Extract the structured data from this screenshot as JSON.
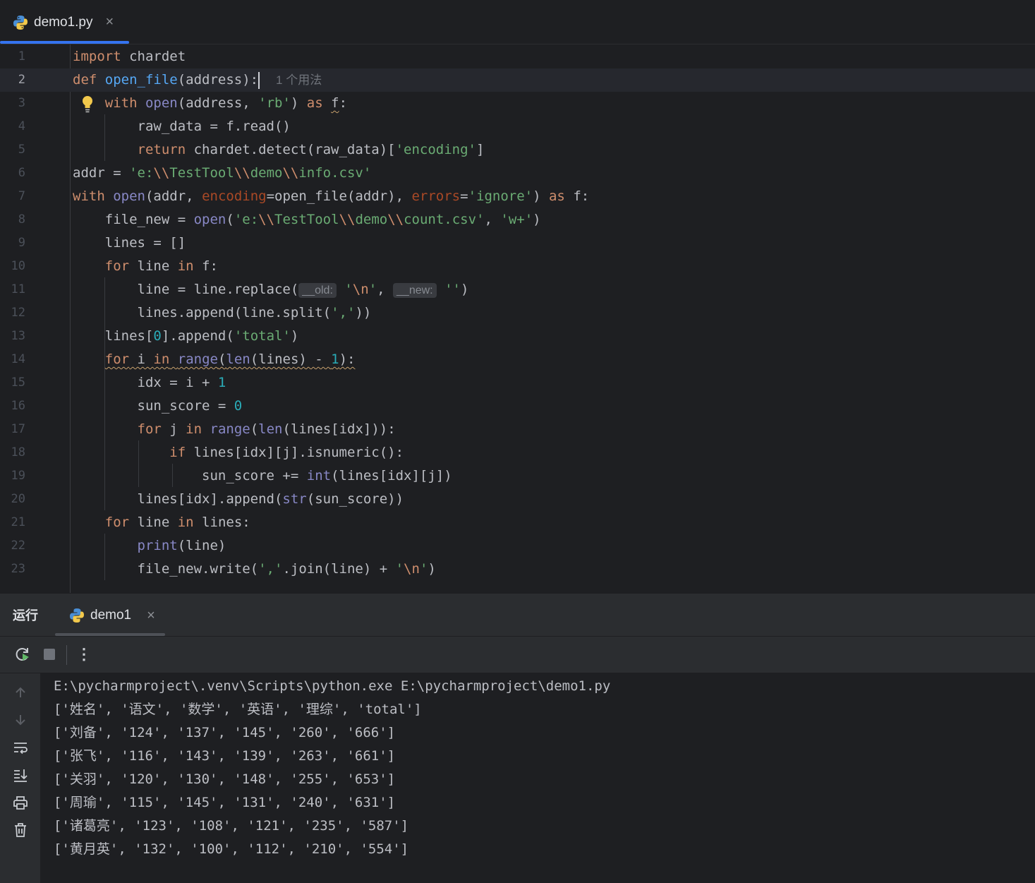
{
  "editor_tab": {
    "filename": "demo1.py",
    "close": "×"
  },
  "editor": {
    "line_numbers": [
      "1",
      "2",
      "3",
      "4",
      "5",
      "6",
      "7",
      "8",
      "9",
      "10",
      "11",
      "12",
      "13",
      "14",
      "15",
      "16",
      "17",
      "18",
      "19",
      "20",
      "21",
      "22",
      "23"
    ],
    "usage_hint": "1 个用法",
    "inlay_old": "__old:",
    "inlay_new": "__new:",
    "lines": {
      "l1": [
        "import",
        " chardet"
      ],
      "l2": [
        "def",
        " ",
        "open_file",
        "(address):"
      ],
      "l3": [
        "with",
        " ",
        "open",
        "(address, ",
        "'rb'",
        ") ",
        "as",
        " ",
        "f",
        ":"
      ],
      "l4": [
        "raw_data = f.read()"
      ],
      "l5": [
        "return",
        " chardet.detect(raw_data)[",
        "'encoding'",
        "]"
      ],
      "l6": [
        "addr = ",
        "'e:",
        "\\\\",
        "TestTool",
        "\\\\",
        "demo",
        "\\\\",
        "info.csv'"
      ],
      "l7": [
        "with",
        " ",
        "open",
        "(addr, ",
        "encoding",
        "=open_file(addr), ",
        "errors",
        "=",
        "'ignore'",
        ") ",
        "as",
        " f:"
      ],
      "l8": [
        "file_new = ",
        "open",
        "(",
        "'e:",
        "\\\\",
        "TestTool",
        "\\\\",
        "demo",
        "\\\\",
        "count.csv'",
        ", ",
        "'w+'",
        ")"
      ],
      "l9": [
        "lines = []"
      ],
      "l10": [
        "for",
        " line ",
        "in",
        " f:"
      ],
      "l11": [
        "line = line.replace(",
        " ",
        "'",
        "\\n",
        "'",
        ", ",
        " ",
        "''",
        ")"
      ],
      "l12": [
        "lines.append(line.split(",
        "','",
        "))"
      ],
      "l13": [
        "lines[",
        "0",
        "].append(",
        "'total'",
        ")"
      ],
      "l14": [
        "for",
        " i ",
        "in",
        " ",
        "range",
        "(",
        "len",
        "(lines) - ",
        "1",
        "):"
      ],
      "l15": [
        "idx = i + ",
        "1"
      ],
      "l16": [
        "sun_score = ",
        "0"
      ],
      "l17": [
        "for",
        " j ",
        "in",
        " ",
        "range",
        "(",
        "len",
        "(lines[idx])):"
      ],
      "l18": [
        "if",
        " lines[idx][j].isnumeric():"
      ],
      "l19": [
        "sun_score += ",
        "int",
        "(lines[idx][j])"
      ],
      "l20": [
        "lines[idx].append(",
        "str",
        "(sun_score))"
      ],
      "l21": [
        "for",
        " line ",
        "in",
        " lines:"
      ],
      "l22": [
        "print",
        "(line)"
      ],
      "l23": [
        "file_new.write(",
        "','",
        ".join(line) + ",
        "'",
        "\\n",
        "'",
        ")"
      ]
    }
  },
  "run_panel": {
    "title": "运行",
    "tab_name": "demo1",
    "close": "×",
    "toolbar": {
      "rerun_icon": "rerun-icon",
      "stop_icon": "stop-icon",
      "more_icon": "more-vertical-icon",
      "more_glyph": "⋮"
    },
    "sidebar": [
      "arrow-up-icon",
      "arrow-down-icon",
      "soft-wrap-icon",
      "scroll-to-end-icon",
      "print-icon",
      "trash-icon"
    ],
    "console_lines": [
      "E:\\pycharmproject\\.venv\\Scripts\\python.exe E:\\pycharmproject\\demo1.py",
      "['姓名', '语文', '数学', '英语', '理综', 'total']",
      "['刘备', '124', '137', '145', '260', '666']",
      "['张飞', '116', '143', '139', '263', '661']",
      "['关羽', '120', '130', '148', '255', '653']",
      "['周瑜', '115', '145', '131', '240', '631']",
      "['诸葛亮', '123', '108', '121', '235', '587']",
      "['黄月英', '132', '100', '112', '210', '554']"
    ]
  },
  "colors": {
    "background": "#1e1f22",
    "panel": "#2b2d30",
    "keyword": "#cf8e6d",
    "function": "#56a8f5",
    "builtin": "#8888c6",
    "string": "#6aab73",
    "number": "#2aacb8",
    "parameter": "#aa4926",
    "accent": "#3574f0"
  }
}
